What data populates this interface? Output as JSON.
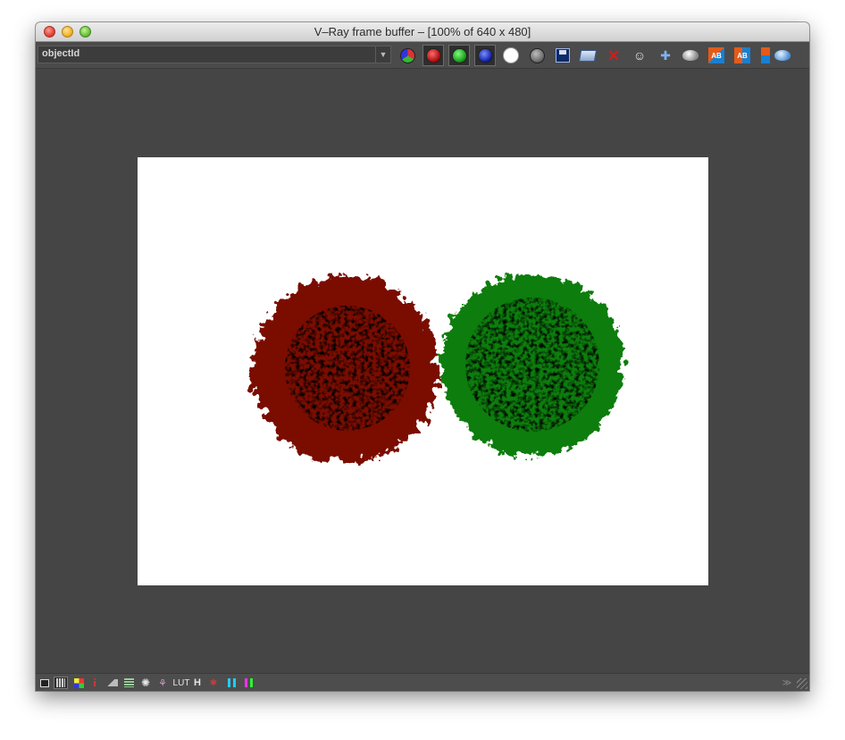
{
  "window": {
    "title": "V–Ray frame buffer – [100% of 640 x 480]"
  },
  "toolbar": {
    "channel_select_value": "objectId",
    "buttons": [
      {
        "name": "rgb-channels-icon",
        "pressed": false
      },
      {
        "name": "red-channel-icon",
        "pressed": true
      },
      {
        "name": "green-channel-icon",
        "pressed": true
      },
      {
        "name": "blue-channel-icon",
        "pressed": true
      },
      {
        "name": "alpha-channel-icon",
        "pressed": false
      },
      {
        "name": "monochrome-icon",
        "pressed": false
      },
      {
        "name": "save-image-icon",
        "pressed": false
      },
      {
        "name": "load-image-icon",
        "pressed": false
      },
      {
        "name": "clear-image-icon",
        "pressed": false
      },
      {
        "name": "track-mouse-icon",
        "pressed": false
      },
      {
        "name": "region-render-icon",
        "pressed": false
      },
      {
        "name": "render-last-icon",
        "pressed": false
      },
      {
        "name": "history-ab-diagonal-icon",
        "pressed": false
      },
      {
        "name": "history-ab-horizontal-icon",
        "pressed": false
      },
      {
        "name": "history-ab-vertical-icon",
        "pressed": false
      },
      {
        "name": "render-teapot-icon",
        "pressed": false
      }
    ]
  },
  "render": {
    "image_description_colors": {
      "background": "#ffffff",
      "left_sphere": "#7a0c00",
      "right_sphere": "#0a7d0a",
      "fur_shadow": "#000000"
    }
  },
  "statusbar": {
    "items": [
      {
        "name": "frame-icon",
        "label": ""
      },
      {
        "name": "color-corrections-icon",
        "label": ""
      },
      {
        "name": "pixel-aspect-icon",
        "label": ""
      },
      {
        "name": "info-icon",
        "label": "i"
      },
      {
        "name": "levels-icon",
        "label": ""
      },
      {
        "name": "curve-icon",
        "label": ""
      },
      {
        "name": "exposure-icon",
        "label": ""
      },
      {
        "name": "histogram-icon",
        "label": ""
      },
      {
        "name": "lut-label",
        "label": "LUT"
      },
      {
        "name": "histogram-h-label",
        "label": "H"
      },
      {
        "name": "color-clamp-icon",
        "label": ""
      },
      {
        "name": "stereo-cyan-icon",
        "label": ""
      },
      {
        "name": "stereo-magenta-icon",
        "label": ""
      }
    ]
  }
}
